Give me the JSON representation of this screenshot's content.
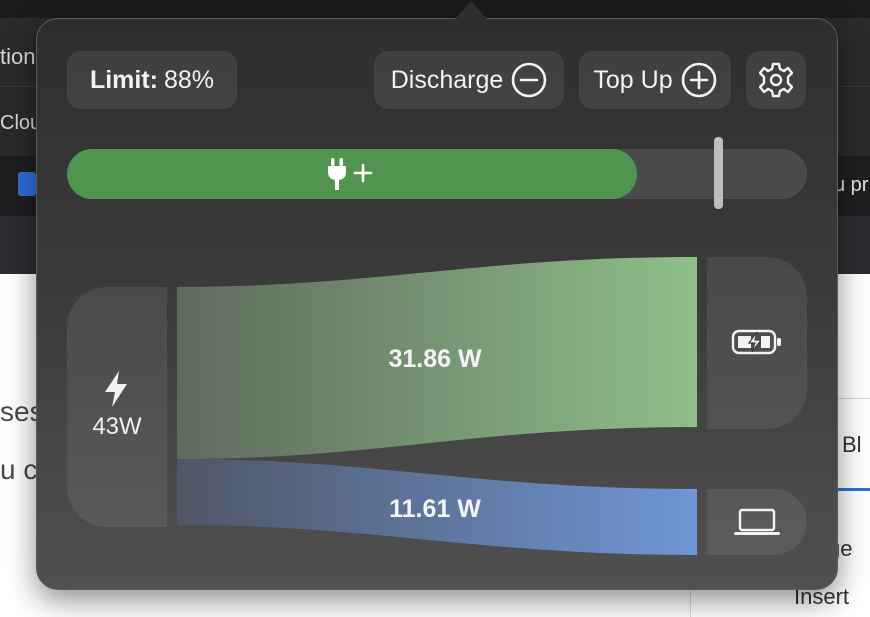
{
  "background_app": {
    "fragments": {
      "left_1": "tion",
      "left_2": "Clou",
      "right_1": "u pr",
      "left_3": "ses",
      "left_4": "u c",
      "right_bl": "Bl",
      "right_ge": "ge",
      "right_insert": "Insert"
    }
  },
  "popover": {
    "limit": {
      "label": "Limit:",
      "value": "88%"
    },
    "discharge_button": {
      "label": "Discharge",
      "icon": "minus-circle-icon"
    },
    "topup_button": {
      "label": "Top Up",
      "icon": "plus-circle-icon"
    },
    "settings_button": {
      "icon": "gear-icon"
    },
    "charge_bar": {
      "level_fraction": 0.77,
      "limit_fraction": 0.88,
      "fill_color": "#509450",
      "icon": "plug-plus-icon"
    },
    "power_flow": {
      "source": {
        "icon": "bolt-icon",
        "label": "43W"
      },
      "to_battery": {
        "value": "31.86 W",
        "color": "#8fbf8a",
        "icon": "battery-charging-icon"
      },
      "to_system": {
        "value": "11.61 W",
        "color": "#6f96d6",
        "icon": "laptop-icon"
      }
    }
  }
}
